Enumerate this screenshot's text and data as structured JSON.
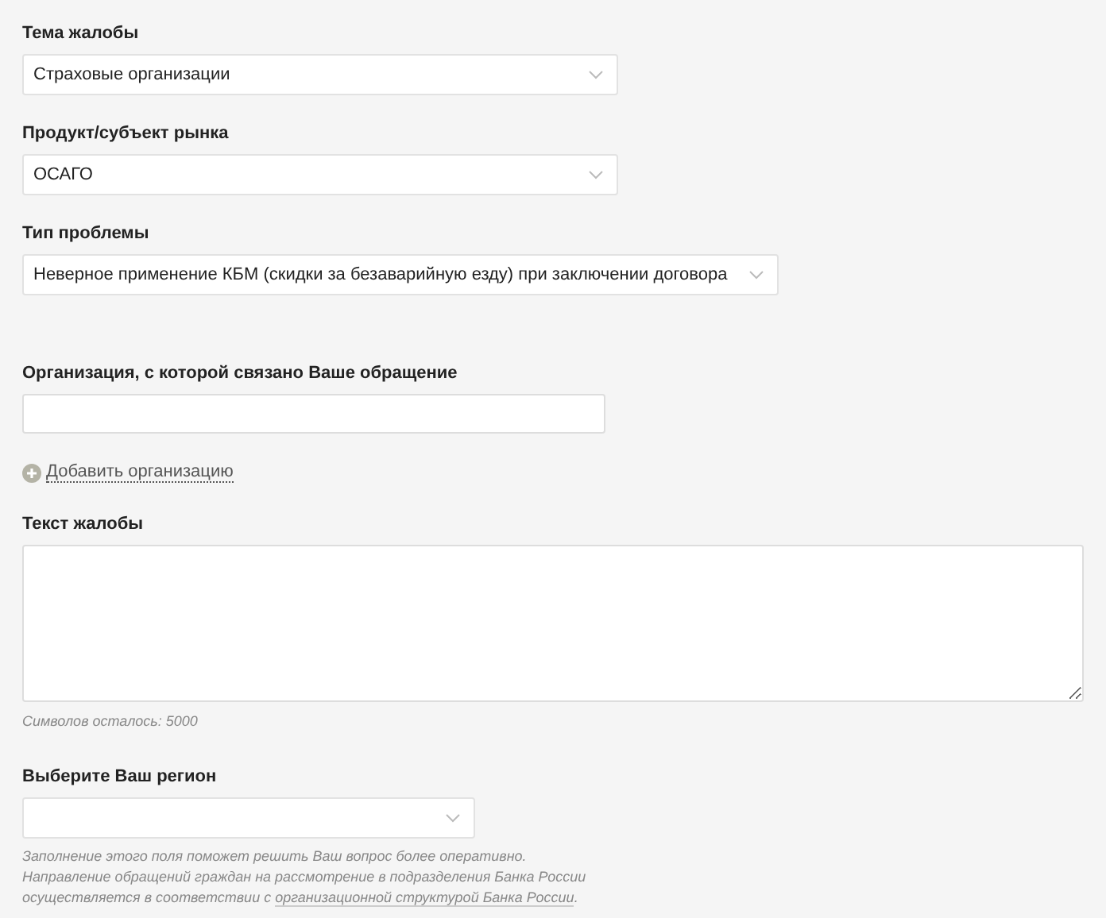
{
  "fields": [
    {
      "kind": "select",
      "label": "Тема жалобы",
      "value": "Страховые организации"
    },
    {
      "kind": "select",
      "label": "Продукт/субъект рынка",
      "value": "ОСАГО"
    },
    {
      "kind": "select",
      "label": "Тип проблемы",
      "value": "Неверное применение КБМ (скидки за безаварийную езду) при заключении договора"
    },
    {
      "kind": "input",
      "label": "Организация, с которой связано Ваше обращение",
      "add_link": "Добавить организацию"
    },
    {
      "kind": "textarea",
      "label": "Текст жалобы",
      "counter": "Символов осталось: 5000"
    },
    {
      "kind": "select",
      "label": "Выберите Ваш регион",
      "hint_lines": [
        "Заполнение этого поля поможет решить Ваш вопрос более оперативно.",
        "Направление обращений граждан на рассмотрение в подразделения Банка России",
        "осуществляется в соответствии с "
      ],
      "hint_link": "организационной структурой Банка России",
      "hint_end": "."
    }
  ]
}
